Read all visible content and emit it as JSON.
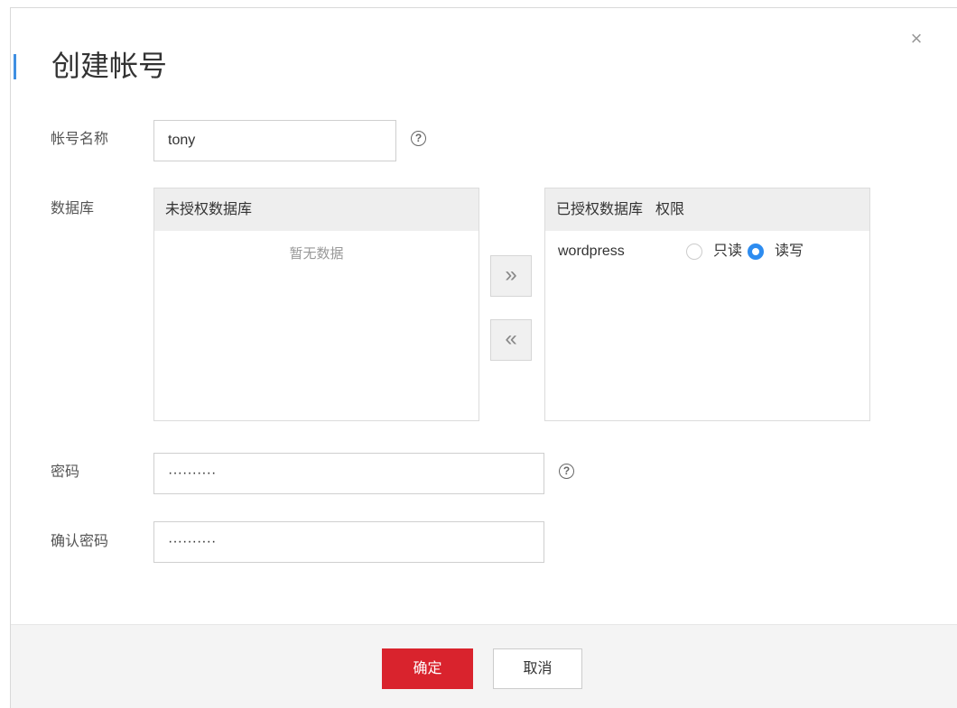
{
  "dialog": {
    "title": "创建帐号",
    "close_glyph": "×"
  },
  "form": {
    "account_name": {
      "label": "帐号名称",
      "value": "tony",
      "help": "?"
    },
    "database": {
      "label": "数据库",
      "unauthorized": {
        "header": "未授权数据库",
        "empty_text": "暂无数据"
      },
      "move_right": "»",
      "move_left": "«",
      "authorized": {
        "header_db": "已授权数据库",
        "header_perm": "权限",
        "rows": [
          {
            "name": "wordpress",
            "readonly_label": "只读",
            "readwrite_label": "读写",
            "selected": "读写"
          }
        ]
      }
    },
    "password": {
      "label": "密码",
      "value": "··········",
      "help": "?"
    },
    "confirm_password": {
      "label": "确认密码",
      "value": "··········"
    }
  },
  "footer": {
    "confirm_label": "确定",
    "cancel_label": "取消"
  },
  "colors": {
    "accent": "#3f8fe2",
    "primary_button": "#d9232d",
    "radio_selected": "#2d8cf0"
  }
}
